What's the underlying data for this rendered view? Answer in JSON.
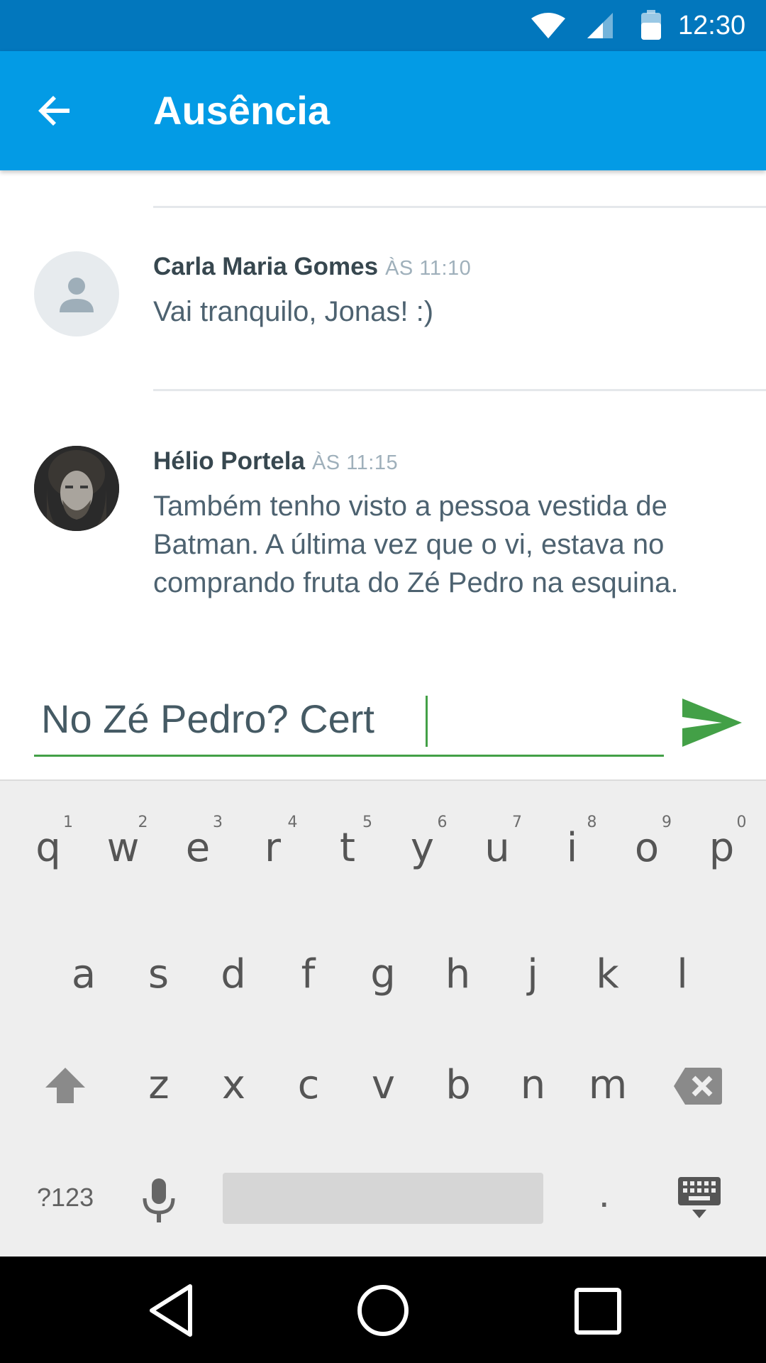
{
  "status_bar": {
    "time": "12:30",
    "icons": [
      "wifi-icon",
      "signal-icon",
      "battery-icon"
    ]
  },
  "app_bar": {
    "title": "Ausência",
    "back_icon": "arrow-back-icon"
  },
  "messages": [
    {
      "author": "Carla Maria Gomes",
      "time": "ÀS 11:10",
      "text": "Vai tranquilo, Jonas! :)",
      "avatar": "person-placeholder-icon"
    },
    {
      "author": "Hélio Portela",
      "time": "ÀS 11:15",
      "text_lines": [
        "Também tenho visto a pessoa vestida de",
        "Batman. A última vez que o vi, estava no",
        "comprando fruta do Zé Pedro na esquina."
      ],
      "avatar": "user-photo"
    }
  ],
  "compose": {
    "value": "No Zé Pedro? Cert",
    "send_icon": "send-icon"
  },
  "keyboard": {
    "row1": [
      {
        "ch": "q",
        "hint": "1"
      },
      {
        "ch": "w",
        "hint": "2"
      },
      {
        "ch": "e",
        "hint": "3"
      },
      {
        "ch": "r",
        "hint": "4"
      },
      {
        "ch": "t",
        "hint": "5"
      },
      {
        "ch": "y",
        "hint": "6"
      },
      {
        "ch": "u",
        "hint": "7"
      },
      {
        "ch": "i",
        "hint": "8"
      },
      {
        "ch": "o",
        "hint": "9"
      },
      {
        "ch": "p",
        "hint": "0"
      }
    ],
    "row2": [
      "a",
      "s",
      "d",
      "f",
      "g",
      "h",
      "j",
      "k",
      "l"
    ],
    "row3": [
      "z",
      "x",
      "c",
      "v",
      "b",
      "n",
      "m"
    ],
    "symbols_label": "?123",
    "period_label": ".",
    "shift_icon": "shift-icon",
    "backspace_icon": "backspace-icon",
    "mic_icon": "mic-icon",
    "keyboard_hide_icon": "keyboard-hide-icon"
  },
  "colors": {
    "status_bar": "#0277bd",
    "app_bar": "#039be5",
    "accent_green": "#43a047",
    "keyboard_bg": "#eeeeee"
  }
}
